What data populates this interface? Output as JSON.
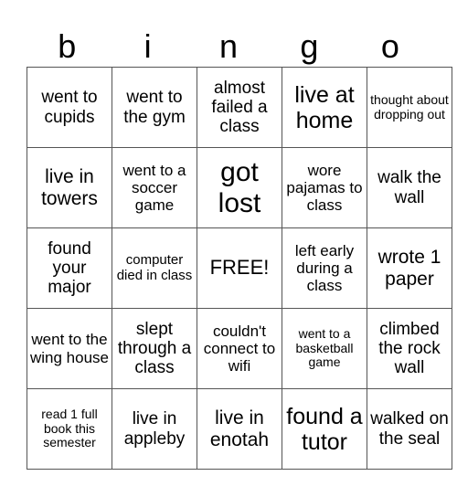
{
  "header": {
    "letters": [
      "b",
      "i",
      "n",
      "g",
      "o"
    ]
  },
  "grid": {
    "rows": [
      [
        "went to cupids",
        "went to the gym",
        "almost failed a class",
        "live at home",
        "thought about dropping out"
      ],
      [
        "live in towers",
        "went to a soccer game",
        "got lost",
        "wore pajamas to class",
        "walk the wall"
      ],
      [
        "found your major",
        "computer died in class",
        "FREE!",
        "left early during a class",
        "wrote 1 paper"
      ],
      [
        "went to the wing house",
        "slept through a class",
        "couldn't connect to wifi",
        "went to a basketball game",
        "climbed the rock wall"
      ],
      [
        "read 1 full book this semester",
        "live in appleby",
        "live in enotah",
        "found a tutor",
        "walked on the seal"
      ]
    ]
  }
}
